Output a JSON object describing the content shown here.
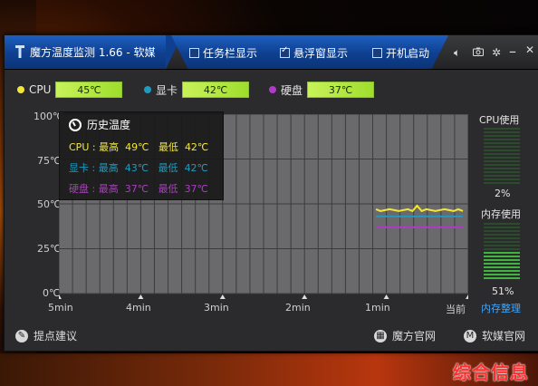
{
  "app": {
    "title": "魔方温度监测 1.66 - 软媒",
    "logo_icon": "thermometer-icon"
  },
  "toolbar": {
    "options": [
      {
        "label": "任务栏显示",
        "checked": false
      },
      {
        "label": "悬浮窗显示",
        "checked": true
      },
      {
        "label": "开机启动",
        "checked": false
      }
    ],
    "icons": [
      "speaker-icon",
      "camera-icon",
      "gear-icon",
      "minimize-icon",
      "close-icon"
    ]
  },
  "sensors": [
    {
      "name": "CPU",
      "value": "45℃",
      "color": "#f2e63a"
    },
    {
      "name": "显卡",
      "value": "42℃",
      "color": "#1f9bbf"
    },
    {
      "name": "硬盘",
      "value": "37℃",
      "color": "#b03ac8"
    }
  ],
  "chart_data": {
    "type": "line",
    "title": "历史温度",
    "y_ticks": [
      "100℃",
      "75℃",
      "50℃",
      "25℃",
      "0℃"
    ],
    "x_ticks": [
      "5min",
      "4min",
      "3min",
      "2min",
      "1min",
      "当前"
    ],
    "ylim": [
      0,
      100
    ],
    "grid": true,
    "x_minutes_ago_range": [
      5,
      0
    ],
    "series": [
      {
        "name": "CPU",
        "color": "#f2e63a",
        "x": [
          0.95,
          0.9,
          0.8,
          0.7,
          0.6,
          0.55,
          0.5,
          0.45,
          0.4,
          0.3,
          0.2,
          0.1,
          0.05,
          0.0
        ],
        "y": [
          47,
          46,
          47,
          46,
          47,
          46,
          49,
          46,
          47,
          46,
          47,
          46,
          47,
          46
        ]
      },
      {
        "name": "显卡",
        "color": "#1f9bbf",
        "x": [
          0.95,
          0.0
        ],
        "y": [
          43,
          43
        ]
      },
      {
        "name": "硬盘",
        "color": "#b03ac8",
        "x": [
          0.95,
          0.0
        ],
        "y": [
          37,
          37
        ]
      }
    ]
  },
  "legend": {
    "title": "历史温度",
    "rows": [
      {
        "name": "CPU",
        "max_label": "最高",
        "max": "49℃",
        "min_label": "最低",
        "min": "42℃",
        "color": "#f2e63a"
      },
      {
        "name": "显卡",
        "max_label": "最高",
        "max": "43℃",
        "min_label": "最低",
        "min": "42℃",
        "color": "#1f9bbf"
      },
      {
        "name": "硬盘",
        "max_label": "最高",
        "max": "37℃",
        "min_label": "最低",
        "min": "37℃",
        "color": "#b03ac8"
      }
    ]
  },
  "right_panel": {
    "cpu_label": "CPU使用",
    "cpu_value": "2%",
    "cpu_fraction": 0.02,
    "mem_label": "内存使用",
    "mem_value": "51%",
    "mem_fraction": 0.51,
    "mem_cleanup": "内存整理"
  },
  "footer": {
    "suggest": "提点建议",
    "mofang_site": "魔方官网",
    "ruanmei_site": "软媒官网"
  },
  "watermark": "综合信息"
}
